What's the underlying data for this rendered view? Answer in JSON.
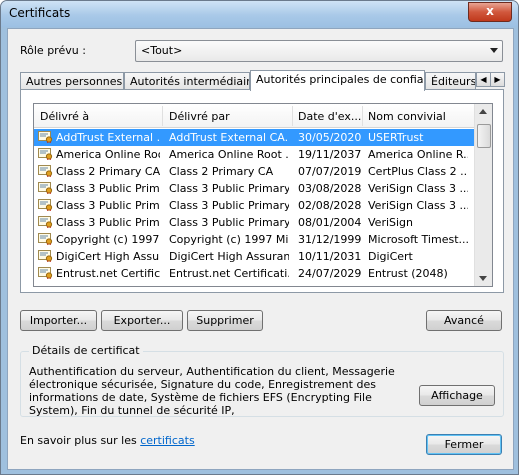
{
  "window": {
    "title": "Certificats",
    "close_label": "x"
  },
  "role": {
    "label": "Rôle prévu :",
    "value": "<Tout>"
  },
  "tabs": [
    {
      "label": "Autres personnes"
    },
    {
      "label": "Autorités intermédiaires"
    },
    {
      "label": "Autorités principales de confiance"
    },
    {
      "label": "Éditeurs a"
    }
  ],
  "list": {
    "columns": [
      "Délivré à",
      "Délivré par",
      "Date d'ex...",
      "Nom convivial"
    ],
    "rows": [
      [
        "AddTrust External ...",
        "AddTrust External CA...",
        "30/05/2020",
        "USERTrust"
      ],
      [
        "America Online Roo...",
        "America Online Root ...",
        "19/11/2037",
        "America Online R..."
      ],
      [
        "Class 2 Primary CA",
        "Class 2 Primary CA",
        "07/07/2019",
        "CertPlus Class 2 ..."
      ],
      [
        "Class 3 Public Prima...",
        "Class 3 Public Primary ...",
        "03/08/2028",
        "VeriSign Class 3 ..."
      ],
      [
        "Class 3 Public Prima...",
        "Class 3 Public Primary ...",
        "02/08/2028",
        "VeriSign Class 3 ..."
      ],
      [
        "Class 3 Public Prima...",
        "Class 3 Public Primary ...",
        "08/01/2004",
        "VeriSign"
      ],
      [
        "Copyright (c) 1997 ...",
        "Copyright (c) 1997 Mi...",
        "31/12/1999",
        "Microsoft Timest..."
      ],
      [
        "DigiCert High Assur...",
        "DigiCert High Assuran...",
        "10/11/2031",
        "DigiCert"
      ],
      [
        "Entrust.net Certific...",
        "Entrust.net Certificati...",
        "24/07/2029",
        "Entrust (2048)"
      ]
    ]
  },
  "buttons": {
    "import": "Importer...",
    "export": "Exporter...",
    "delete": "Supprimer",
    "advanced": "Avancé",
    "view": "Affichage",
    "close": "Fermer"
  },
  "details": {
    "title": "Détails de certificat",
    "text": "Authentification du serveur, Authentification du client, Messagerie électronique sécurisée, Signature du code, Enregistrement des informations de date, Système de fichiers EFS (Encrypting File System), Fin du tunnel de sécurité IP,"
  },
  "footer": {
    "text": "En savoir plus sur les ",
    "link": "certificats"
  },
  "colors": {
    "selection": "#3399ff",
    "link": "#0066cc",
    "accent": "#3c7fb1"
  }
}
